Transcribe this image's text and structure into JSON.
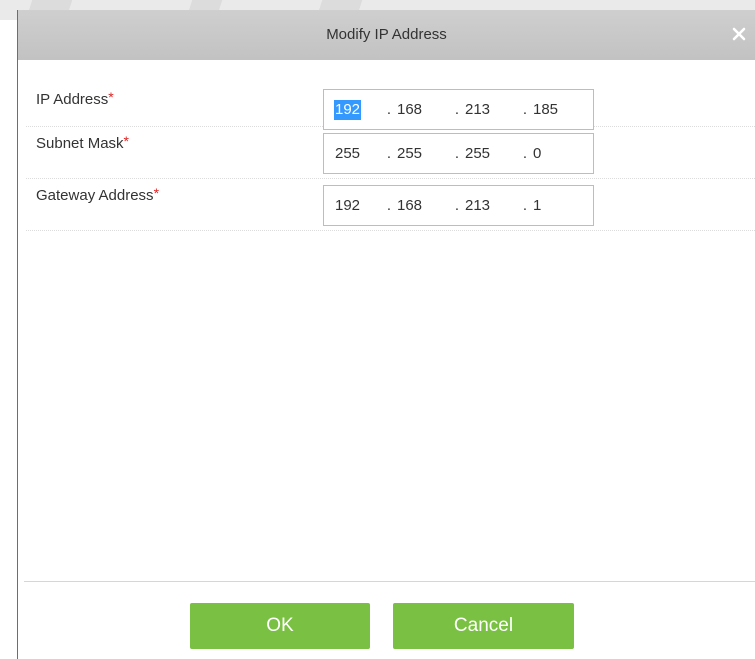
{
  "dialog": {
    "title": "Modify IP Address",
    "close_icon": "close-icon"
  },
  "form": {
    "rows": [
      {
        "label": "IP Address",
        "required_mark": "*",
        "octets": [
          "192",
          "168",
          "213",
          "185"
        ],
        "selected_octet": 0
      },
      {
        "label": "Subnet Mask",
        "required_mark": "*",
        "octets": [
          "255",
          "255",
          "255",
          "0"
        ]
      },
      {
        "label": "Gateway Address",
        "required_mark": "*",
        "octets": [
          "192",
          "168",
          "213",
          "1"
        ]
      }
    ],
    "octet_separator": "."
  },
  "buttons": {
    "ok_label": "OK",
    "cancel_label": "Cancel"
  },
  "colors": {
    "title_bar": "#c8c8c8",
    "button_green": "#7ac143",
    "required_red": "#e02020",
    "selection_blue": "#3399ff"
  }
}
